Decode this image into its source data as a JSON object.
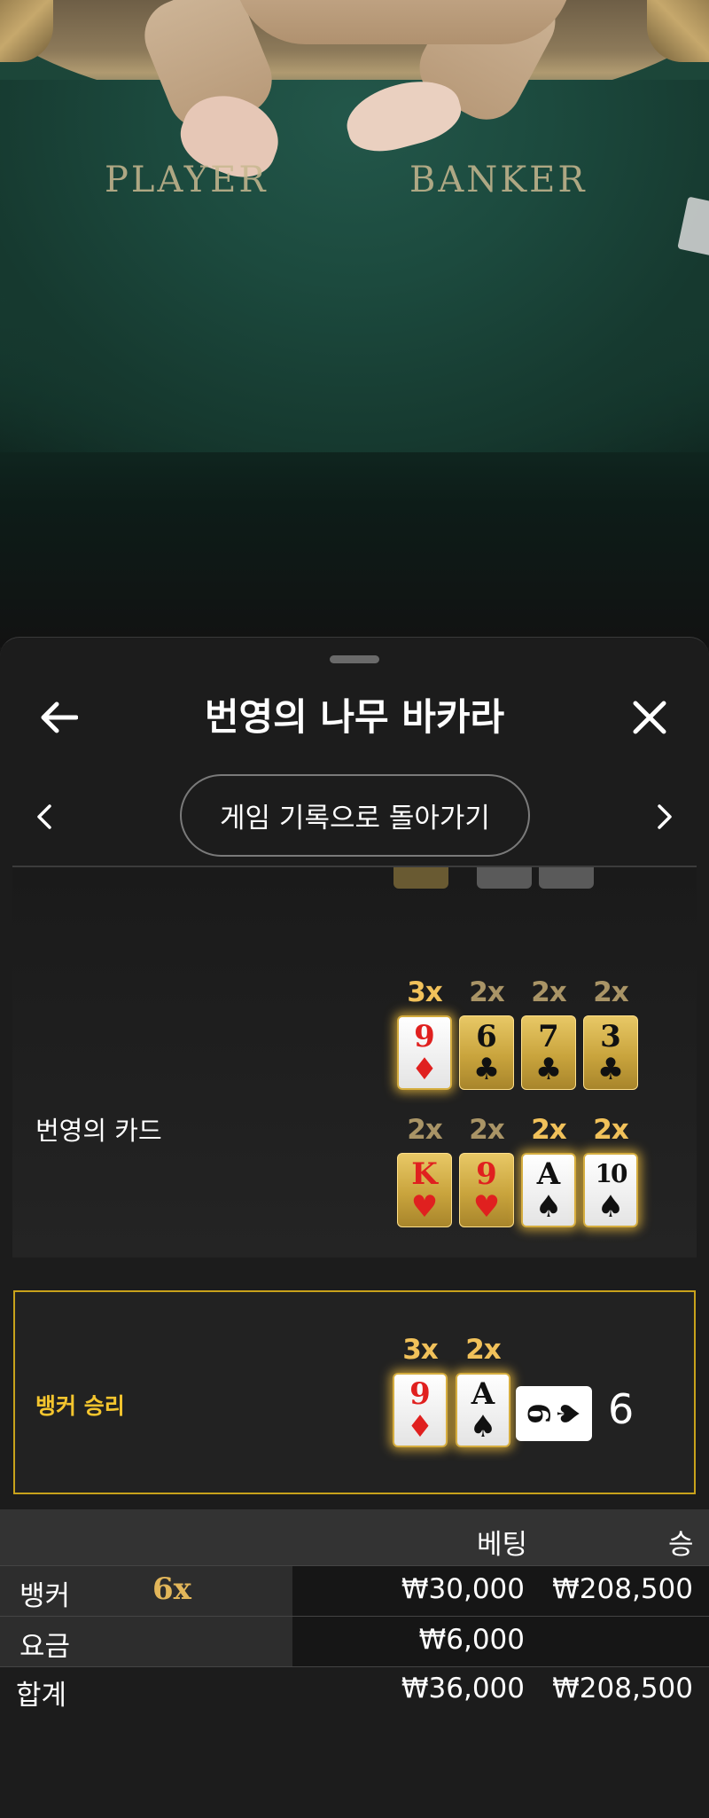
{
  "video": {
    "felt_labels": {
      "player": "PLAYER",
      "banker": "BANKER"
    }
  },
  "sheet": {
    "back_icon": "arrow-left-icon",
    "close_icon": "close-icon",
    "title": "번영의 나무 바카라",
    "prev_icon": "chevron-left-icon",
    "next_icon": "chevron-right-icon",
    "back_to_history": "게임 기록으로 돌아가기"
  },
  "prosperity": {
    "label": "번영의 카드",
    "rows": [
      [
        {
          "multiplier": "3x",
          "rank": "9",
          "suit": "♦",
          "color": "red",
          "style": "white"
        },
        {
          "multiplier": "2x",
          "rank": "6",
          "suit": "♣",
          "color": "black",
          "style": "gold"
        },
        {
          "multiplier": "2x",
          "rank": "7",
          "suit": "♣",
          "color": "black",
          "style": "gold"
        },
        {
          "multiplier": "2x",
          "rank": "3",
          "suit": "♣",
          "color": "black",
          "style": "gold"
        }
      ],
      [
        {
          "multiplier": "2x",
          "rank": "K",
          "suit": "♥",
          "color": "red",
          "style": "gold"
        },
        {
          "multiplier": "2x",
          "rank": "9",
          "suit": "♥",
          "color": "red",
          "style": "gold"
        },
        {
          "multiplier": "2x",
          "rank": "A",
          "suit": "♠",
          "color": "black",
          "style": "white"
        },
        {
          "multiplier": "2x",
          "rank": "10",
          "suit": "♠",
          "color": "black",
          "style": "white"
        }
      ]
    ]
  },
  "result": {
    "label": "뱅커 승리",
    "cards": [
      {
        "multiplier": "3x",
        "rank": "9",
        "suit": "♦",
        "color": "red"
      },
      {
        "multiplier": "2x",
        "rank": "A",
        "suit": "♠",
        "color": "black"
      }
    ],
    "side_card": {
      "rank": "6",
      "suit": "♠"
    },
    "score": "6"
  },
  "bets": {
    "headers": {
      "bet": "베팅",
      "win": "승"
    },
    "rows": [
      {
        "name": "뱅커",
        "multiplier": "6x",
        "bet": "₩30,000",
        "win": "₩208,500"
      },
      {
        "name": "요금",
        "multiplier": "",
        "bet": "₩6,000",
        "win": ""
      }
    ],
    "total": {
      "name": "합계",
      "bet": "₩36,000",
      "win": "₩208,500"
    }
  },
  "colors": {
    "accent_gold": "#f4c52e",
    "card_gold": "#c9a43d",
    "red_suit": "#e0201f"
  }
}
